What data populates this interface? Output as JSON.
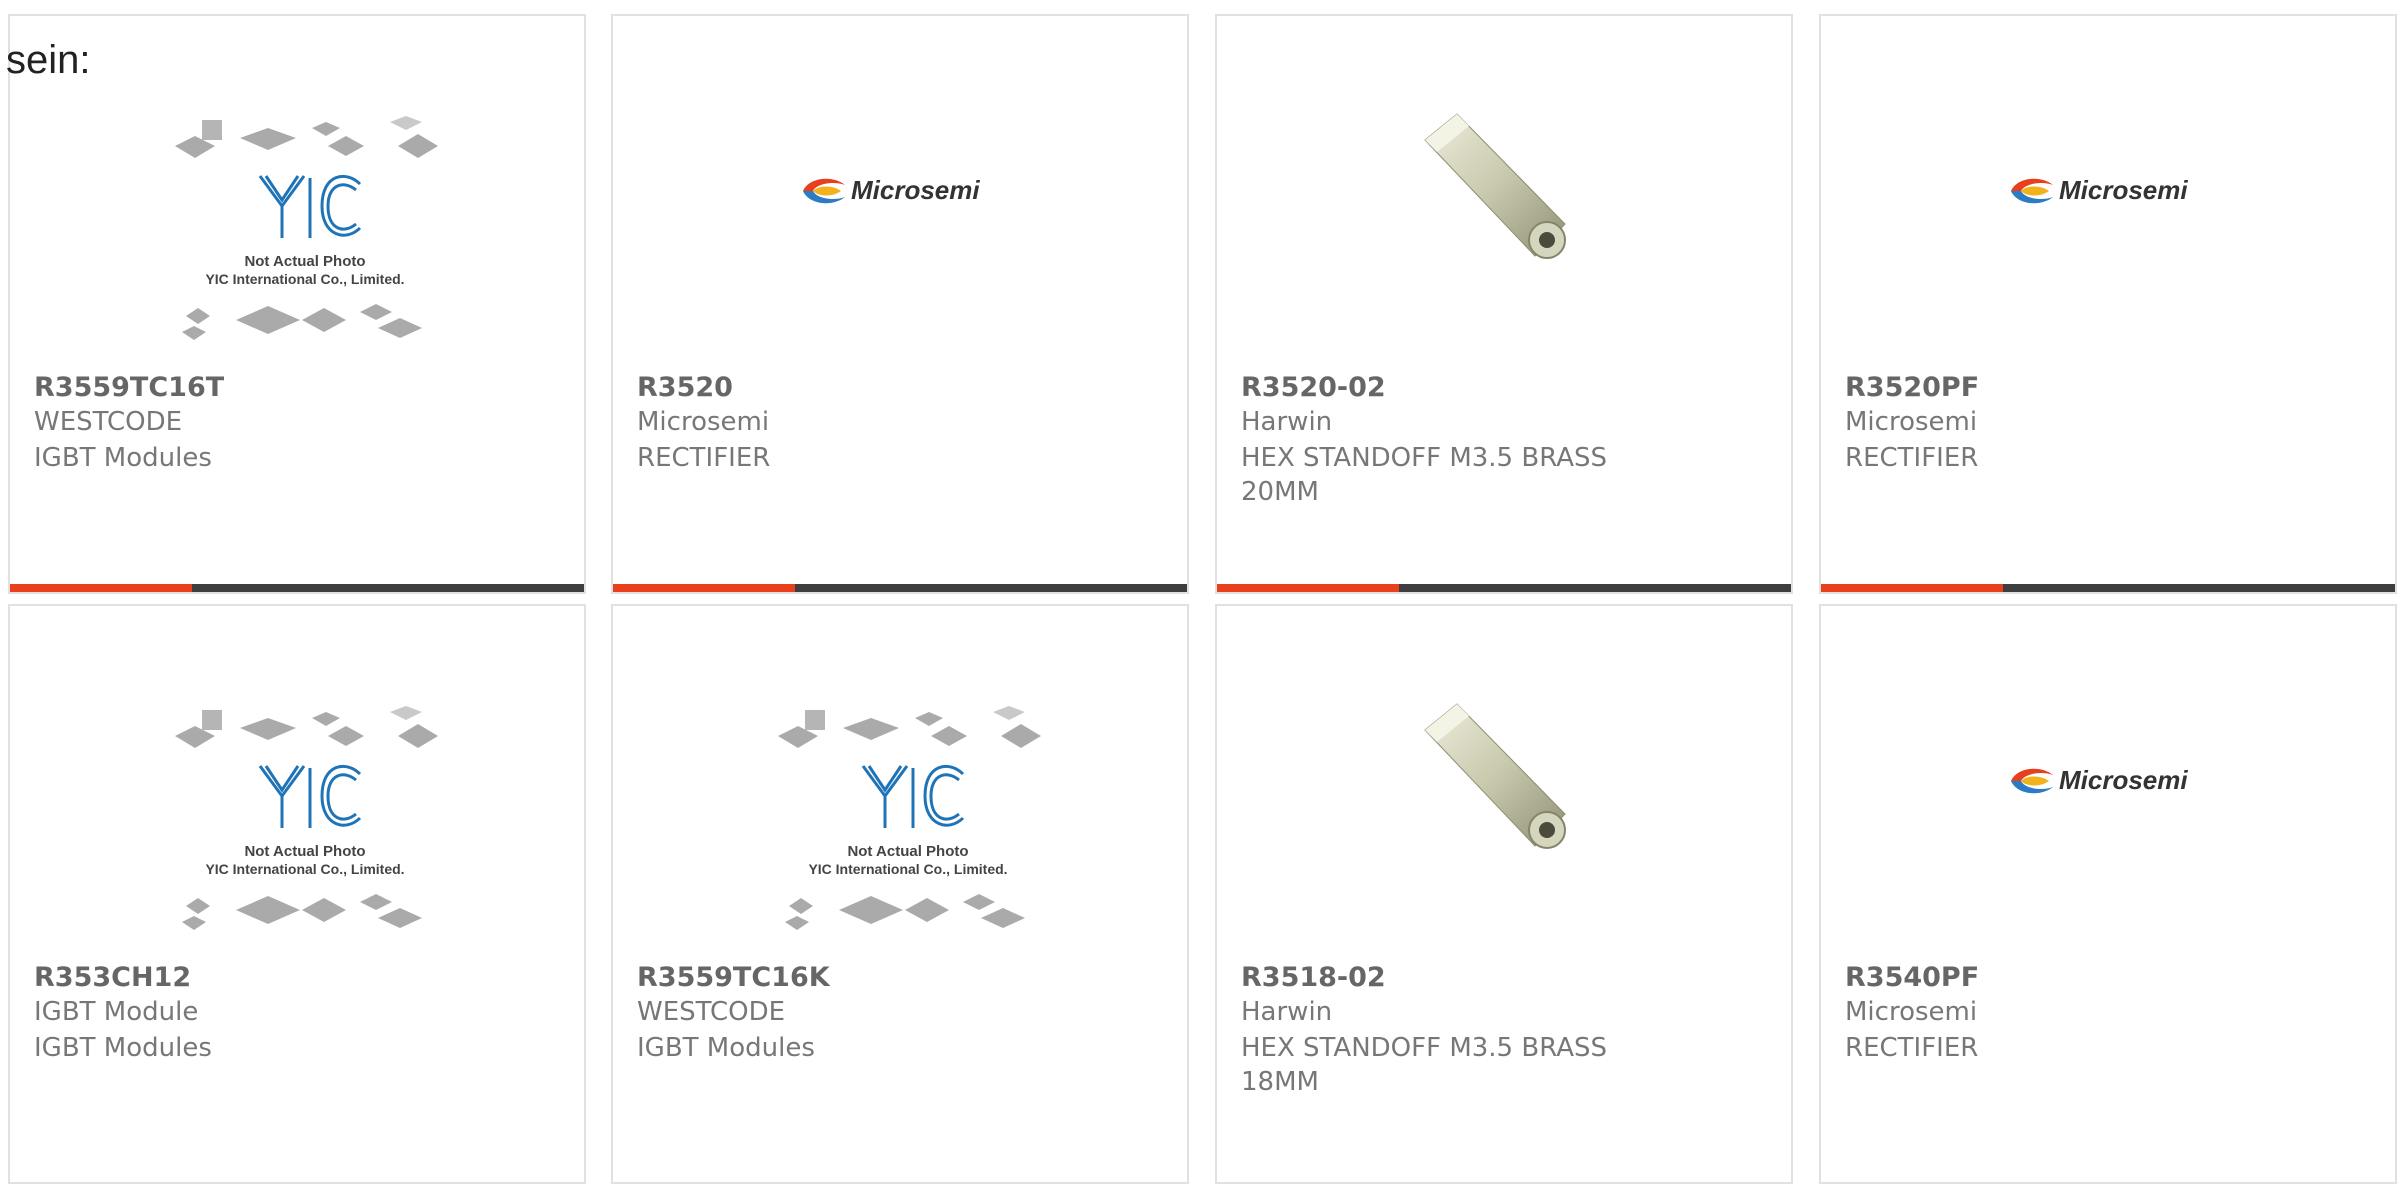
{
  "intro_text": "sein:",
  "accent_color": "#e8401c",
  "bar_color": "#3e3e3e",
  "placeholder": {
    "line1": "Not Actual Photo",
    "line2": "YIC International Co., Limited."
  },
  "logo_text": "Microsemi",
  "cards": [
    {
      "part": "R3559TC16T",
      "maker": "WESTCODE",
      "desc": "IGBT Modules",
      "image": "yic-placeholder"
    },
    {
      "part": "R3520",
      "maker": "Microsemi",
      "desc": "RECTIFIER",
      "image": "microsemi-logo"
    },
    {
      "part": "R3520-02",
      "maker": "Harwin",
      "desc": "HEX STANDOFF M3.5 BRASS 20MM",
      "image": "hex-standoff"
    },
    {
      "part": "R3520PF",
      "maker": "Microsemi",
      "desc": "RECTIFIER",
      "image": "microsemi-logo"
    },
    {
      "part": "R353CH12",
      "maker": "IGBT Module",
      "desc": "IGBT Modules",
      "image": "yic-placeholder"
    },
    {
      "part": "R3559TC16K",
      "maker": "WESTCODE",
      "desc": "IGBT Modules",
      "image": "yic-placeholder"
    },
    {
      "part": "R3518-02",
      "maker": "Harwin",
      "desc": "HEX STANDOFF M3.5 BRASS 18MM",
      "image": "hex-standoff"
    },
    {
      "part": "R3540PF",
      "maker": "Microsemi",
      "desc": "RECTIFIER",
      "image": "microsemi-logo"
    }
  ]
}
